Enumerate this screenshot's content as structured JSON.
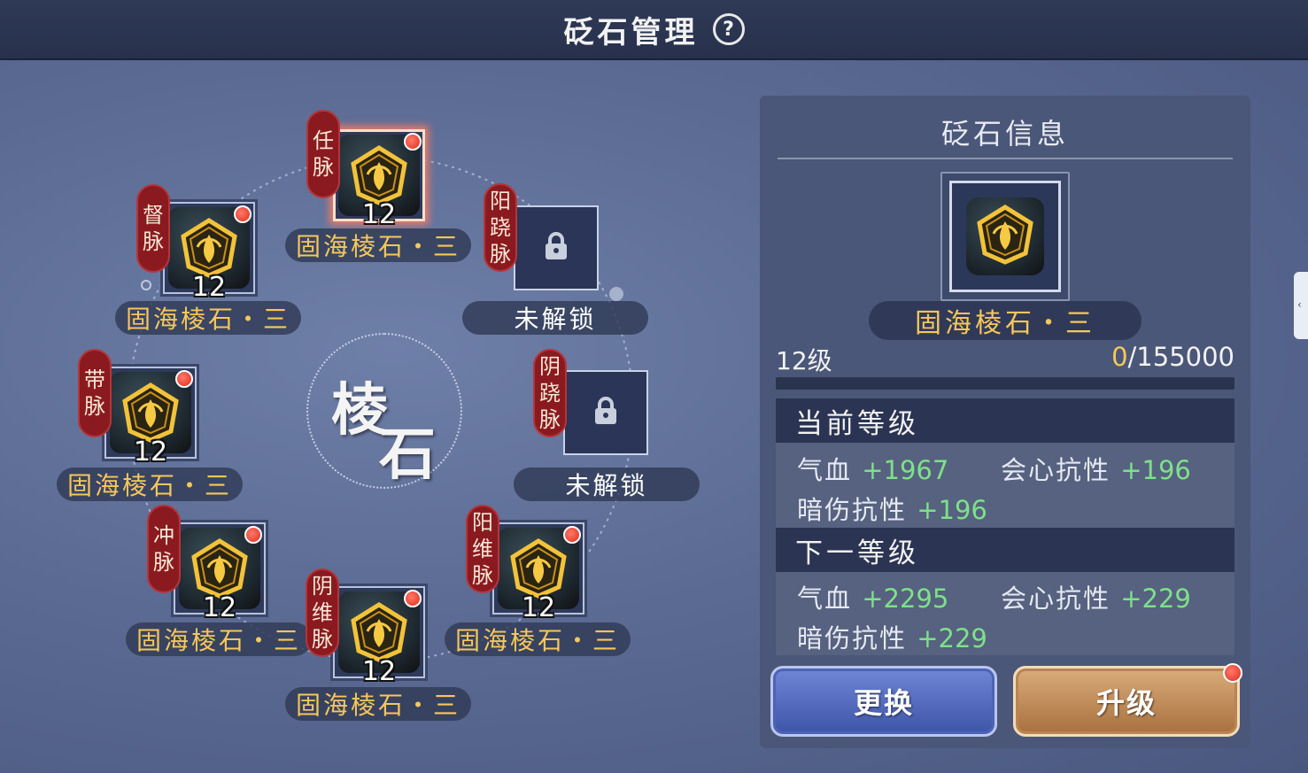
{
  "header": {
    "title": "砭石管理",
    "help_label": "?"
  },
  "center": {
    "char1": "棱",
    "char2": "石"
  },
  "slots": [
    {
      "meridian": [
        "任",
        "脉"
      ],
      "name": "固海棱石・三",
      "level": "12",
      "state": "equipped",
      "selected": true,
      "badge": true
    },
    {
      "meridian": [
        "督",
        "脉"
      ],
      "name": "固海棱石・三",
      "level": "12",
      "state": "equipped",
      "badge": true
    },
    {
      "meridian": [
        "阳",
        "跷",
        "脉"
      ],
      "name": "未解锁",
      "state": "locked"
    },
    {
      "meridian": [
        "带",
        "脉"
      ],
      "name": "固海棱石・三",
      "level": "12",
      "state": "equipped",
      "badge": true
    },
    {
      "meridian": [
        "阴",
        "跷",
        "脉"
      ],
      "name": "未解锁",
      "state": "locked"
    },
    {
      "meridian": [
        "冲",
        "脉"
      ],
      "name": "固海棱石・三",
      "level": "12",
      "state": "equipped",
      "badge": true
    },
    {
      "meridian": [
        "阳",
        "维",
        "脉"
      ],
      "name": "固海棱石・三",
      "level": "12",
      "state": "equipped",
      "badge": true
    },
    {
      "meridian": [
        "阴",
        "维",
        "脉"
      ],
      "name": "固海棱石・三",
      "level": "12",
      "state": "equipped",
      "badge": true
    }
  ],
  "panel": {
    "title": "砭石信息",
    "gem_name": "固海棱石・三",
    "level_text": "12级",
    "exp_current": "0",
    "exp_max": "/155000",
    "exp_progress": 0,
    "current": {
      "header": "当前等级",
      "stats": [
        {
          "label": "气血",
          "value": "+1967"
        },
        {
          "label": "会心抗性",
          "value": "+196"
        },
        {
          "label": "暗伤抗性",
          "value": "+196"
        }
      ]
    },
    "next": {
      "header": "下一等级",
      "stats": [
        {
          "label": "气血",
          "value": "+2295"
        },
        {
          "label": "会心抗性",
          "value": "+229"
        },
        {
          "label": "暗伤抗性",
          "value": "+229"
        }
      ]
    },
    "buttons": {
      "change": "更换",
      "upgrade": "升级"
    }
  },
  "side_tab": {
    "glyph": "‹"
  },
  "colors": {
    "gem_name": "#f7c75a",
    "stat_value": "#7ee08a",
    "meridian_tag": "#8a1a1f",
    "badge": "#e02b1b"
  }
}
